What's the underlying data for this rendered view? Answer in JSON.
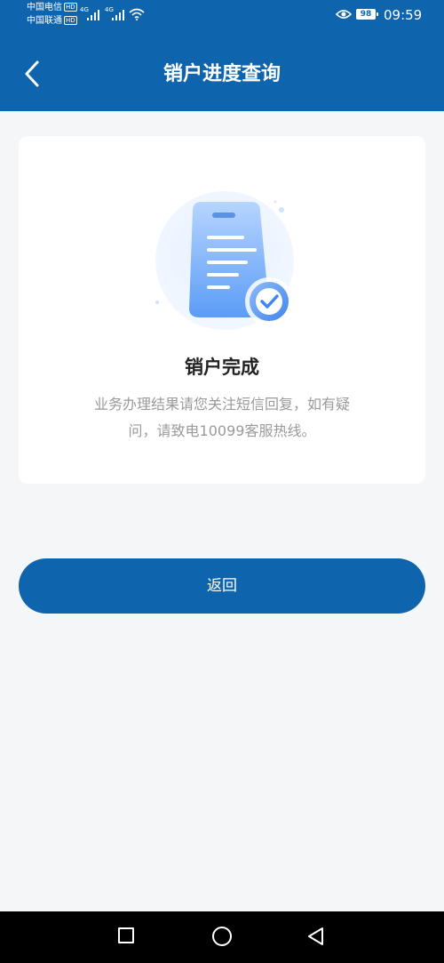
{
  "status_bar": {
    "carrier1": "中国电信",
    "carrier2": "中国联通",
    "hd_badge": "HD",
    "network1": "4G",
    "network2": "4G",
    "battery": "98",
    "time": "09:59"
  },
  "header": {
    "title": "销户进度查询"
  },
  "result": {
    "title": "销户完成",
    "description": "业务办理结果请您关注短信回复，如有疑问，请致电10099客服热线。"
  },
  "actions": {
    "return_label": "返回"
  },
  "colors": {
    "primary": "#0f65ad",
    "background": "#f5f6f8",
    "card": "#ffffff",
    "title_text": "#222222",
    "secondary_text": "#9a9a9a"
  },
  "icons": {
    "back": "chevron-left-icon",
    "wifi": "wifi-icon",
    "eye": "eye-icon",
    "nav_recent": "square-icon",
    "nav_home": "circle-icon",
    "nav_back": "triangle-back-icon"
  }
}
